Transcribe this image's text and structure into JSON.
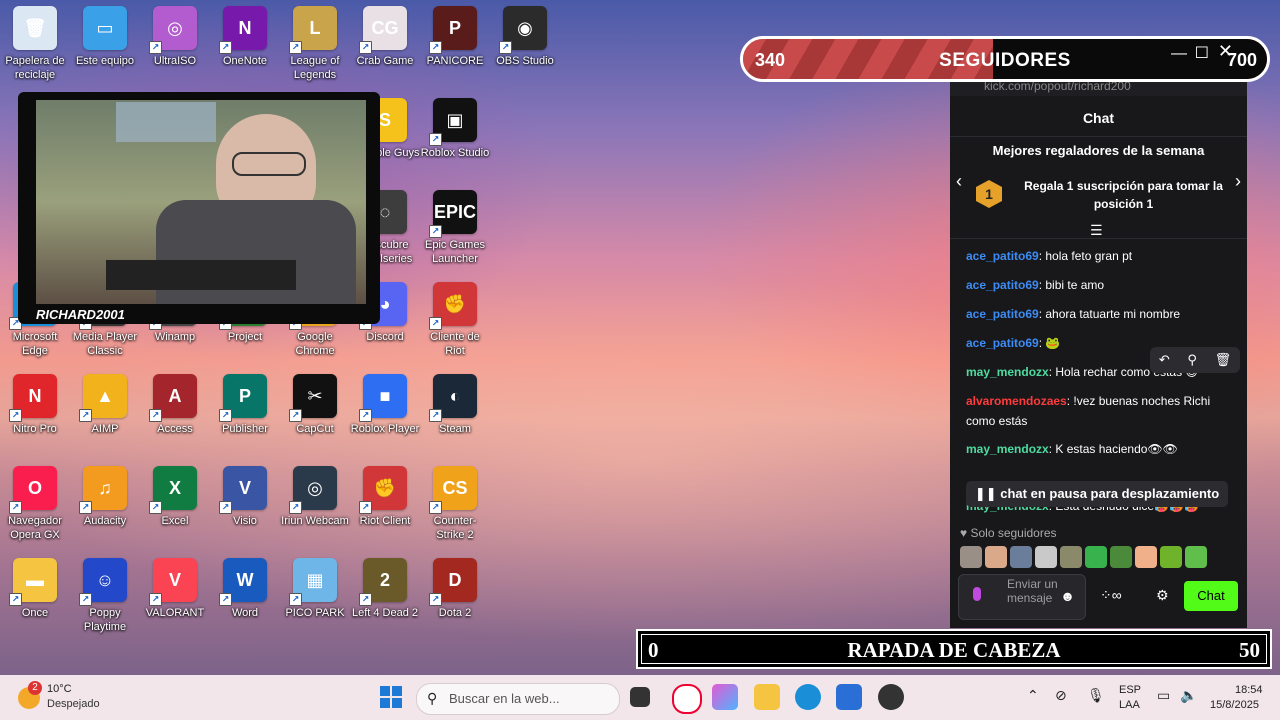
{
  "desktop": {
    "icons": [
      {
        "label": "Papelera de reciclaje",
        "glyph": "🗑",
        "color": "#dbe7f3"
      },
      {
        "label": "Este equipo",
        "glyph": "▭",
        "color": "#3aa0e8"
      },
      {
        "label": "UltraISO",
        "glyph": "◎",
        "color": "#b25ccf"
      },
      {
        "label": "OneNote",
        "glyph": "N",
        "color": "#7719aa"
      },
      {
        "label": "League of Legends",
        "glyph": "L",
        "color": "#c9a44a"
      },
      {
        "label": "Crab Game",
        "glyph": "CG",
        "color": "#e9e0e6"
      },
      {
        "label": "PANICORE",
        "glyph": "P",
        "color": "#5a1b1b"
      },
      {
        "label": "OBS Studio",
        "glyph": "◉",
        "color": "#2b2b2b"
      },
      {
        "label": "Stumble Guys",
        "glyph": "S",
        "color": "#f5c21b"
      },
      {
        "label": "Roblox Studio",
        "glyph": "▣",
        "color": "#111111"
      },
      {
        "label": "Descubre Steelseries",
        "glyph": "◌",
        "color": "#3d3d3d"
      },
      {
        "label": "Epic Games Launcher",
        "glyph": "EPIC",
        "color": "#111111"
      },
      {
        "label": "Microsoft Edge",
        "glyph": "e",
        "color": "#1a8fd8"
      },
      {
        "label": "Media Player Classic",
        "glyph": "▶",
        "color": "#333"
      },
      {
        "label": "Winamp",
        "glyph": "⚡",
        "color": "#444"
      },
      {
        "label": "Project",
        "glyph": "P",
        "color": "#2f7d32"
      },
      {
        "label": "Google Chrome",
        "glyph": "●",
        "color": "#e9a41b"
      },
      {
        "label": "Discord",
        "glyph": "◕",
        "color": "#5865f2"
      },
      {
        "label": "Cliente de Riot",
        "glyph": "✊",
        "color": "#d13639"
      },
      {
        "label": "Nitro Pro",
        "glyph": "N",
        "color": "#e0262a"
      },
      {
        "label": "AIMP",
        "glyph": "▲",
        "color": "#f2b21b"
      },
      {
        "label": "Access",
        "glyph": "A",
        "color": "#a4262c"
      },
      {
        "label": "Publisher",
        "glyph": "P",
        "color": "#077568"
      },
      {
        "label": "CapCut",
        "glyph": "✂",
        "color": "#111"
      },
      {
        "label": "Roblox Player",
        "glyph": "■",
        "color": "#2e6ef2"
      },
      {
        "label": "Steam",
        "glyph": "◐",
        "color": "#1b2838"
      },
      {
        "label": "Navegador Opera GX",
        "glyph": "O",
        "color": "#fa1e4e"
      },
      {
        "label": "Audacity",
        "glyph": "♫",
        "color": "#f39b1e"
      },
      {
        "label": "Excel",
        "glyph": "X",
        "color": "#107c41"
      },
      {
        "label": "Visio",
        "glyph": "V",
        "color": "#3955a3"
      },
      {
        "label": "Iriun Webcam",
        "glyph": "◎",
        "color": "#2b3a4a"
      },
      {
        "label": "Riot Client",
        "glyph": "✊",
        "color": "#d13639"
      },
      {
        "label": "Counter-Strike 2",
        "glyph": "CS",
        "color": "#f0a21b"
      },
      {
        "label": "Once",
        "glyph": "▬",
        "color": "#f5c542"
      },
      {
        "label": "Poppy Playtime",
        "glyph": "☺",
        "color": "#2348c9"
      },
      {
        "label": "VALORANT",
        "glyph": "V",
        "color": "#fa4454"
      },
      {
        "label": "Word",
        "glyph": "W",
        "color": "#185abd"
      },
      {
        "label": "PICO PARK",
        "glyph": "▦",
        "color": "#6fb6e8"
      },
      {
        "label": "Left 4 Dead 2",
        "glyph": "2",
        "color": "#6a5a2a"
      },
      {
        "label": "Dota 2",
        "glyph": "D",
        "color": "#a3281f"
      }
    ]
  },
  "top_counter": {
    "left": "340",
    "title": "SEGUIDORES",
    "right": "700",
    "progress_fraction": 0.0
  },
  "bottom_counter": {
    "left": "0",
    "title": "RAPADA DE CABEZA",
    "right": "50",
    "progress_fraction": 0.0
  },
  "webcam": {
    "name": "RICHARD2001"
  },
  "chat": {
    "url": "kick.com/popout/richard200",
    "header": "Chat",
    "gifters_title": "Mejores regaladores de la semana",
    "gift_rank": "1",
    "gift_desc": "Regala 1 suscripción para tomar la posición 1",
    "messages": [
      {
        "user": "ace_patito69",
        "text": ": hola feto gran pt",
        "color": "#3d8cf5"
      },
      {
        "user": "ace_patito69",
        "text": ": bibi te amo",
        "color": "#3d8cf5"
      },
      {
        "user": "ace_patito69",
        "text": ": ahora tatuarte mi nombre",
        "color": "#3d8cf5"
      },
      {
        "user": "ace_patito69",
        "text": ": 🐸",
        "color": "#3d8cf5"
      },
      {
        "user": "may_mendozx",
        "text": ": Hola rechar como estas 😊",
        "color": "#4fdba0"
      },
      {
        "user": "alvaromendozaes",
        "text": ": !vez buenas noches Richi como estás",
        "color": "#ff3b3b"
      },
      {
        "user": "may_mendozx",
        "text": ": K estas haciendo👁👁",
        "color": "#4fdba0"
      },
      {
        "user": "may_mendozx",
        "text": ": Esta desnudo dice🥵🥵🥵",
        "color": "#4fdba0"
      }
    ],
    "paused": "chat en pausa para desplazamiento",
    "followers_only": "Solo seguidores",
    "input_placeholder": "Enviar un mensaje",
    "send_label": "Chat"
  },
  "taskbar": {
    "weather_badge": "2",
    "temp": "10°C",
    "condition": "Despejado",
    "search_placeholder": "Buscar en la web...",
    "lang": "ESP",
    "layout": "LAA",
    "time": "18:54",
    "date": "15/8/2025"
  }
}
